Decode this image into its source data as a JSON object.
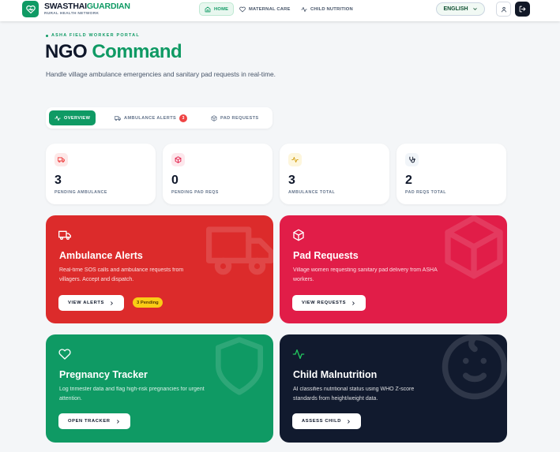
{
  "header": {
    "brand_part1": "SWASTHAI",
    "brand_part2": "GUARDIAN",
    "brand_sub": "RURAL HEALTH NETWORK",
    "nav": [
      {
        "label": "HOME",
        "icon": "home-icon",
        "active": true
      },
      {
        "label": "MATERNAL CARE",
        "icon": "heart-icon",
        "active": false
      },
      {
        "label": "CHILD NUTRITION",
        "icon": "activity-icon",
        "active": false
      }
    ],
    "language": "ENGLISH"
  },
  "hero": {
    "eyebrow": "ASHA FIELD WORKER PORTAL",
    "title_part1": "NGO",
    "title_part2": "Command",
    "subtitle": "Handle village ambulance emergencies and sanitary pad requests in real-time."
  },
  "tabs": [
    {
      "label": "OVERVIEW",
      "icon": "activity-icon",
      "active": true
    },
    {
      "label": "AMBULANCE ALERTS",
      "icon": "truck-icon",
      "badge": "3",
      "active": false
    },
    {
      "label": "PAD REQUESTS",
      "icon": "package-icon",
      "active": false
    }
  ],
  "stats": [
    {
      "value": "3",
      "label": "PENDING AMBULANCE",
      "icon": "truck-icon",
      "color": "#ef4444",
      "bg": "#fde8e8"
    },
    {
      "value": "0",
      "label": "PENDING PAD REQS",
      "icon": "package-icon",
      "color": "#e11d48",
      "bg": "#fde7ec"
    },
    {
      "value": "3",
      "label": "AMBULANCE TOTAL",
      "icon": "activity-icon",
      "color": "#d4a017",
      "bg": "#fdf6dc"
    },
    {
      "value": "2",
      "label": "PAD REQS TOTAL",
      "icon": "stethoscope-icon",
      "color": "#0f172a",
      "bg": "#f1f5f9"
    }
  ],
  "cards": [
    {
      "title": "Ambulance Alerts",
      "desc": "Real-time SOS calls and ambulance requests from villagers. Accept and dispatch.",
      "button": "VIEW ALERTS",
      "pill": "3 Pending",
      "color": "#dc2b2b",
      "icon": "truck-icon"
    },
    {
      "title": "Pad Requests",
      "desc": "Village women requesting sanitary pad delivery from ASHA workers.",
      "button": "VIEW REQUESTS",
      "color": "#e11d48",
      "icon": "package-icon"
    },
    {
      "title": "Pregnancy Tracker",
      "desc": "Log trimester data and flag high-risk pregnancies for urgent attention.",
      "button": "OPEN TRACKER",
      "color": "#0f9a64",
      "icon": "heart-icon"
    },
    {
      "title": "Child Malnutrition",
      "desc": "AI classifies nutritional status using WHO Z-score standards from height/weight data.",
      "button": "ASSESS CHILD",
      "color": "#111a2e",
      "icon": "activity-icon"
    }
  ]
}
